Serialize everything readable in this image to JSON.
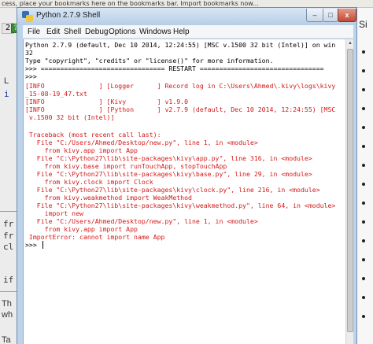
{
  "browser": {
    "bookmark_bar_text": "cess, place your bookmarks here on the bookmarks bar. Import bookmarks now..."
  },
  "background_editor": {
    "tab_labels": [
      "2",
      "?"
    ],
    "fragments": [
      {
        "text": "L",
        "style": "sans"
      },
      {
        "text": "i",
        "style": "blue"
      },
      {
        "text": "fr",
        "style": "mono"
      },
      {
        "text": "fr",
        "style": "mono"
      },
      {
        "text": "cl",
        "style": "mono"
      },
      {
        "text": "if",
        "style": "mono"
      },
      {
        "text": "Th",
        "style": "sans"
      },
      {
        "text": "wh",
        "style": "sans"
      },
      {
        "text": "Ta",
        "style": "sans"
      }
    ]
  },
  "right_sidebar": {
    "heading": "Si"
  },
  "shell_window": {
    "title": "Python 2.7.9 Shell",
    "controls": {
      "minimize": "–",
      "maximize": "□",
      "close": "x"
    },
    "menu": [
      "File",
      "Edit",
      "Shell",
      "Debug",
      "Options",
      "Windows",
      "Help"
    ],
    "colors": {
      "normal": "#000000",
      "output": "#1f1fcf",
      "error": "#d41818"
    },
    "lines": [
      {
        "text": "Python 2.7.9 (default, Dec 10 2014, 12:24:55) [MSC v.1500 32 bit (Intel)] on win",
        "style": "normal"
      },
      {
        "text": "32",
        "style": "normal"
      },
      {
        "text": "Type \"copyright\", \"credits\" or \"license()\" for more information.",
        "style": "normal"
      },
      {
        "text": ">>> ================================ RESTART ================================",
        "style": "normal"
      },
      {
        "text": ">>>",
        "style": "normal"
      },
      {
        "text": "[INFO              ] [Logger      ] Record log in C:\\Users\\Ahmed\\.kivy\\logs\\kivy",
        "style": "red"
      },
      {
        "text": "_15-08-19_47.txt",
        "style": "red"
      },
      {
        "text": "[INFO              ] [Kivy        ] v1.9.0",
        "style": "red"
      },
      {
        "text": "[INFO              ] [Python      ] v2.7.9 (default, Dec 10 2014, 12:24:55) [MSC",
        "style": "red"
      },
      {
        "text": " v.1500 32 bit (Intel)]",
        "style": "red"
      },
      {
        "text": "",
        "style": "red"
      },
      {
        "text": " Traceback (most recent call last):",
        "style": "red"
      },
      {
        "text": "   File \"C:/Users/Ahmed/Desktop/new.py\", line 1, in <module>",
        "style": "red"
      },
      {
        "text": "     from kivy.app import App",
        "style": "red"
      },
      {
        "text": "   File \"C:\\Python27\\lib\\site-packages\\kivy\\app.py\", line 316, in <module>",
        "style": "red"
      },
      {
        "text": "     from kivy.base import runTouchApp, stopTouchApp",
        "style": "red"
      },
      {
        "text": "   File \"C:\\Python27\\lib\\site-packages\\kivy\\base.py\", line 29, in <module>",
        "style": "red"
      },
      {
        "text": "     from kivy.clock import Clock",
        "style": "red"
      },
      {
        "text": "   File \"C:\\Python27\\lib\\site-packages\\kivy\\clock.py\", line 216, in <module>",
        "style": "red"
      },
      {
        "text": "     from kivy.weakmethod import WeakMethod",
        "style": "red"
      },
      {
        "text": "   File \"C:\\Python27\\lib\\site-packages\\kivy\\weakmethod.py\", line 64, in <module>",
        "style": "red"
      },
      {
        "text": "     import new",
        "style": "red"
      },
      {
        "text": "   File \"C:/Users/Ahmed/Desktop/new.py\", line 1, in <module>",
        "style": "red"
      },
      {
        "text": "     from kivy.app import App",
        "style": "red"
      },
      {
        "text": " ImportError: cannot import name App",
        "style": "red"
      },
      {
        "text": ">>>",
        "style": "normal"
      }
    ]
  }
}
